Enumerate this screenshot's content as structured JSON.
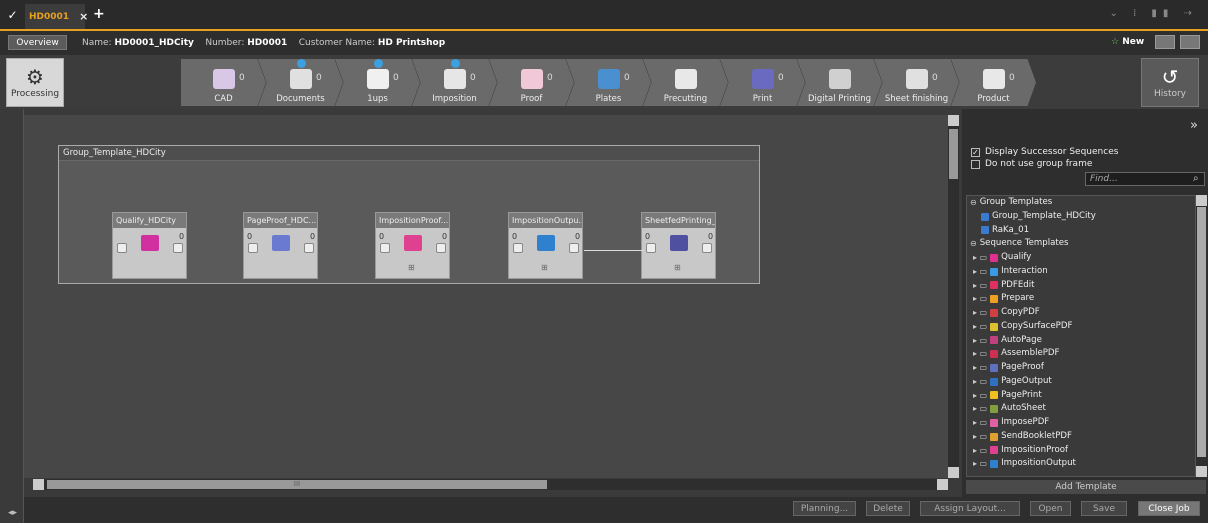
{
  "tabs": {
    "job_tab": "HD0001",
    "close": "×",
    "add": "+"
  },
  "info": {
    "overview": "Overview",
    "name_label": "Name:",
    "name_value": "HD0001_HDCity",
    "number_label": "Number:",
    "number_value": "HD0001",
    "customer_label": "Customer Name:",
    "customer_value": "HD Printshop",
    "new_label": "New"
  },
  "toolbar": {
    "processing": "Processing",
    "history": "History",
    "steps": [
      {
        "label": "CAD",
        "count": "0",
        "color": "#d9c7e8",
        "play": false
      },
      {
        "label": "Documents",
        "count": "0",
        "color": "#e0e0e0",
        "play": true
      },
      {
        "label": "1ups",
        "count": "0",
        "color": "#f0f0f0",
        "play": true
      },
      {
        "label": "Imposition",
        "count": "0",
        "color": "#e6e6e6",
        "play": true
      },
      {
        "label": "Proof",
        "count": "0",
        "color": "#f0c8d8",
        "play": false
      },
      {
        "label": "Plates",
        "count": "0",
        "color": "#4a90d0",
        "play": false
      },
      {
        "label": "Precutting",
        "count": "",
        "color": "#e8e8e8",
        "play": false
      },
      {
        "label": "Print",
        "count": "0",
        "color": "#6a6ac0",
        "play": false
      },
      {
        "label": "Digital Printing",
        "count": "",
        "color": "#d0d0d0",
        "play": false
      },
      {
        "label": "Sheet finishing",
        "count": "0",
        "color": "#e0e0e0",
        "play": false
      },
      {
        "label": "Product",
        "count": "0",
        "color": "#e8e8e8",
        "play": false
      }
    ]
  },
  "canvas": {
    "group_title": "Group_Template_HDCity",
    "nodes": [
      {
        "title": "Qualify_HDCity",
        "in": "",
        "out": "0",
        "main_color": "#d030a0",
        "sub": ""
      },
      {
        "title": "PageProof_HDC...",
        "in": "0",
        "out": "0",
        "main_color": "#6a7ad0",
        "sub": ""
      },
      {
        "title": "ImpositionProof...",
        "in": "0",
        "out": "0",
        "main_color": "#e04090",
        "sub": "⊞"
      },
      {
        "title": "ImpositionOutpu...",
        "in": "0",
        "out": "0",
        "main_color": "#3080d0",
        "sub": "⊞"
      },
      {
        "title": "SheetfedPrinting_H...",
        "in": "0",
        "out": "0",
        "main_color": "#5050a0",
        "sub": "⊞"
      }
    ]
  },
  "side": {
    "display_successor": "Display Successor Sequences",
    "no_group_frame": "Do not use group frame",
    "find_placeholder": "Find...",
    "tree": [
      {
        "kind": "header",
        "label": "Group Templates"
      },
      {
        "kind": "group",
        "label": "Group_Template_HDCity"
      },
      {
        "kind": "group",
        "label": "RaKa_01"
      },
      {
        "kind": "header",
        "label": "Sequence Templates"
      },
      {
        "kind": "seq",
        "label": "Qualify",
        "color": "#e03090"
      },
      {
        "kind": "seq",
        "label": "Interaction",
        "color": "#3a9ae0"
      },
      {
        "kind": "seq",
        "label": "PDFEdit",
        "color": "#e03060"
      },
      {
        "kind": "seq",
        "label": "Prepare",
        "color": "#f0a020"
      },
      {
        "kind": "seq",
        "label": "CopyPDF",
        "color": "#d04040"
      },
      {
        "kind": "seq",
        "label": "CopySurfacePDF",
        "color": "#e0c030"
      },
      {
        "kind": "seq",
        "label": "AutoPage",
        "color": "#c04080"
      },
      {
        "kind": "seq",
        "label": "AssemblePDF",
        "color": "#d03050"
      },
      {
        "kind": "seq",
        "label": "PageProof",
        "color": "#6070c0"
      },
      {
        "kind": "seq",
        "label": "PageOutput",
        "color": "#3070c0"
      },
      {
        "kind": "seq",
        "label": "PagePrint",
        "color": "#f0c020"
      },
      {
        "kind": "seq",
        "label": "AutoSheet",
        "color": "#80a040"
      },
      {
        "kind": "seq",
        "label": "ImposePDF",
        "color": "#e060a0"
      },
      {
        "kind": "seq",
        "label": "SendBookletPDF",
        "color": "#e0a030"
      },
      {
        "kind": "seq",
        "label": "ImpositionProof",
        "color": "#e04090"
      },
      {
        "kind": "seq",
        "label": "ImpositionOutput",
        "color": "#3080d0"
      }
    ],
    "add_template": "Add Template"
  },
  "bottom": {
    "planning": "Planning...",
    "delete": "Delete",
    "assign_layout": "Assign Layout...",
    "open": "Open",
    "save": "Save",
    "close_job": "Close Job",
    "scroll_grip": "III"
  }
}
